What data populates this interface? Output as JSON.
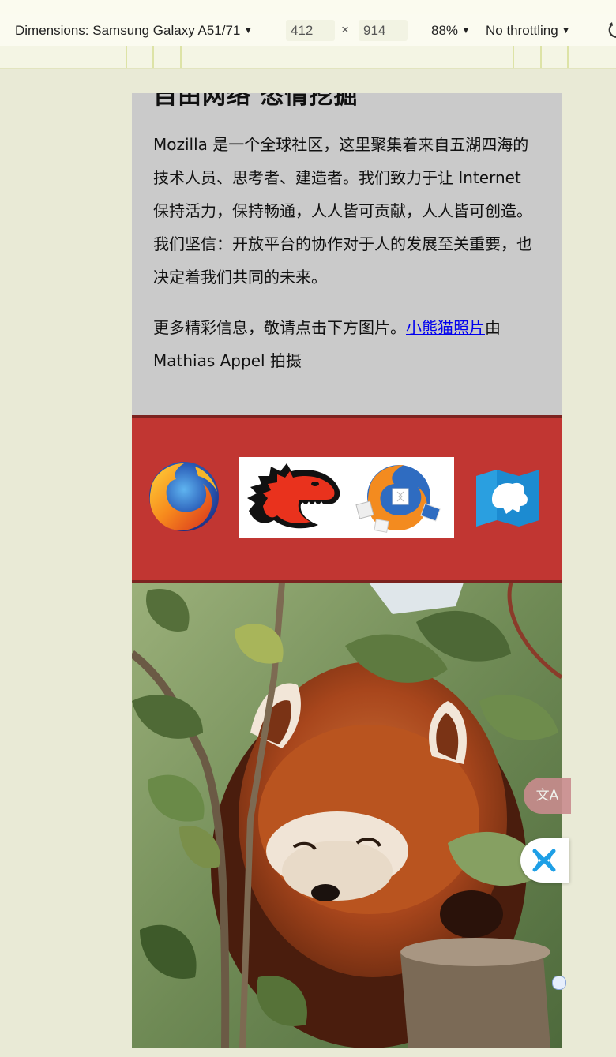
{
  "devtools": {
    "dimensions_label": "Dimensions: Samsung Galaxy A51/71",
    "width_value": "412",
    "times_symbol": "×",
    "height_value": "914",
    "zoom": "88%",
    "throttling": "No throttling",
    "ruler_color": "#dde3a6"
  },
  "page": {
    "heading": "自由网络 恣情挖掘",
    "paragraph1": "Mozilla 是一个全球社区，这里聚集着来自五湖四海的 技术人员、思考者、建造者。我们致力于让 Internet 保持活力，保持畅通，人人皆可贡献，人人皆可创造。我们坚信：开放平台的协作对于人的发展至关重要，也决定着我们共同的未来。",
    "paragraph2_before": "更多精彩信息，敬请点击下方图片。",
    "paragraph2_link": "小熊猫照片",
    "paragraph2_after": "由 Mathias Appel 拍摄",
    "band_color": "#c13632",
    "logos": [
      "firefox-logo",
      "mozilla-dinosaur-logo",
      "firefox-puzzle-logo",
      "firefox-os-logo"
    ],
    "photo": "red-panda-photo"
  },
  "floating": {
    "translate_label": "文A",
    "extension_icon": "butterfly-icon"
  }
}
